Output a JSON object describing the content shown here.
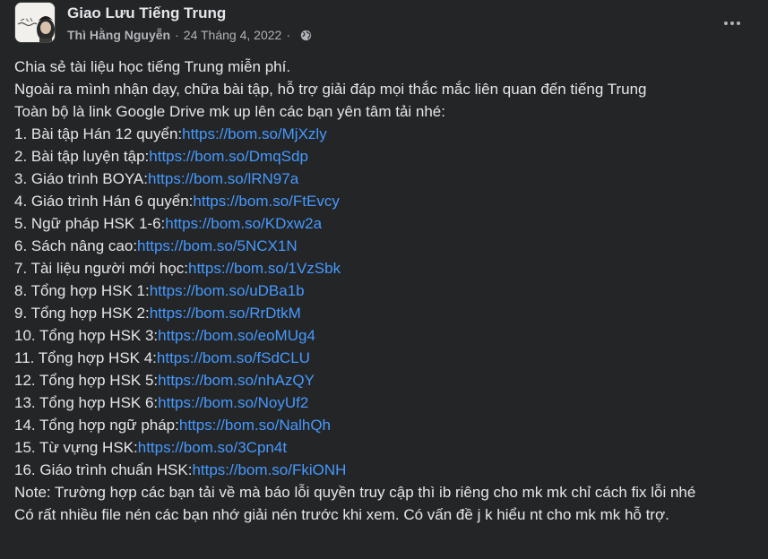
{
  "post": {
    "group_name": "Giao Lưu Tiếng Trung",
    "author": "Thì Hằng Nguyễn",
    "separator": "·",
    "date": "24 Tháng 4, 2022",
    "privacy_icon": "globe-icon",
    "more_icon": "ellipsis-icon",
    "intro": [
      "Chia sẻ tài liệu học tiếng Trung miễn phí.",
      "Ngoài ra mình nhận dạy, chữa bài tập, hỗ trợ giải đáp mọi thắc mắc liên quan đến tiếng Trung",
      "Toàn bộ là link Google Drive mk up lên các bạn yên tâm tải nhé:"
    ],
    "items": [
      {
        "label": "1. Bài tập Hán 12 quyển:",
        "url": "https://bom.so/MjXzly"
      },
      {
        "label": "2. Bài tập luyện tập:",
        "url": "https://bom.so/DmqSdp"
      },
      {
        "label": "3. Giáo trình BOYA:",
        "url": "https://bom.so/lRN97a"
      },
      {
        "label": "4. Giáo trình Hán 6 quyển:",
        "url": "https://bom.so/FtEvcy"
      },
      {
        "label": "5. Ngữ pháp HSK 1-6:",
        "url": "https://bom.so/KDxw2a"
      },
      {
        "label": "6. Sách nâng cao:",
        "url": "https://bom.so/5NCX1N"
      },
      {
        "label": "7. Tài liệu người mới học:",
        "url": "https://bom.so/1VzSbk"
      },
      {
        "label": "8. Tổng hợp HSK 1:",
        "url": "https://bom.so/uDBa1b"
      },
      {
        "label": "9. Tổng hợp HSK 2:",
        "url": "https://bom.so/RrDtkM"
      },
      {
        "label": "10. Tổng hợp HSK 3:",
        "url": "https://bom.so/eoMUg4"
      },
      {
        "label": "11. Tổng hợp HSK 4:",
        "url": "https://bom.so/fSdCLU"
      },
      {
        "label": "12. Tổng hợp HSK 5:",
        "url": "https://bom.so/nhAzQY"
      },
      {
        "label": "13. Tổng hợp HSK 6:",
        "url": "https://bom.so/NoyUf2"
      },
      {
        "label": "14. Tổng hợp ngữ pháp:",
        "url": "https://bom.so/NalhQh"
      },
      {
        "label": "15. Từ vựng HSK:",
        "url": "https://bom.so/3Cpn4t"
      },
      {
        "label": "16. Giáo trình chuẩn HSK:",
        "url": "https://bom.so/FkiONH"
      }
    ],
    "note": "Note: Trường hợp các bạn tải về mà báo lỗi quyền truy cập thì ib riêng cho mk mk chỉ cách fix lỗi nhé",
    "footer": "Có rất nhiều file nén các bạn nhớ giải nén trước khi xem. Có vấn đề j k hiểu nt cho mk mk hỗ trợ."
  },
  "colors": {
    "background": "#242526",
    "text": "#e4e6eb",
    "secondary_text": "#b0b3b8",
    "link": "#4599ff"
  }
}
